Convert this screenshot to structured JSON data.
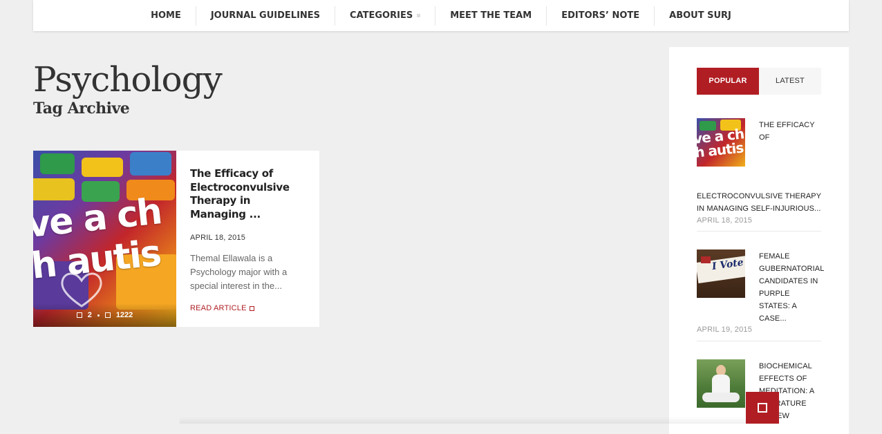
{
  "nav": {
    "items": [
      {
        "label": "HOME"
      },
      {
        "label": "JOURNAL GUIDELINES"
      },
      {
        "label": "CATEGORIES"
      },
      {
        "label": "MEET THE TEAM"
      },
      {
        "label": "EDITORS’ NOTE"
      },
      {
        "label": "ABOUT SURJ"
      }
    ]
  },
  "page": {
    "title": "Psychology",
    "subtitle": "Tag Archive"
  },
  "article": {
    "title": "The Efficacy of Electroconvulsive Therapy in Managing ...",
    "date": "APRIL 18, 2015",
    "excerpt": "Themal Ellawala is a Psychology major with a special interest in the...",
    "read_label": "READ ARTICLE",
    "comments": "2",
    "views": "1222",
    "thumb_text_line1": "ve a ch",
    "thumb_text_line2": "h autis"
  },
  "sidebar": {
    "tabs": {
      "popular": "POPULAR",
      "latest": "LATEST"
    },
    "posts": [
      {
        "title_a": "THE EFFICACY OF",
        "title_b": "ELECTROCONVULSIVE THERAPY IN MANAGING SELF-INJURIOUS...",
        "date": "APRIL 18, 2015"
      },
      {
        "title_a": "FEMALE GUBERNATORIAL CANDIDATES IN PURPLE STATES: A CASE...",
        "date": "APRIL 19, 2015",
        "thumb_text": "I Vote"
      },
      {
        "title_a": "BIOCHEMICAL EFFECTS OF MEDITATION: A LITERATURE REVIEW"
      }
    ]
  },
  "colors": {
    "accent": "#b01e24",
    "background": "#efefef"
  }
}
